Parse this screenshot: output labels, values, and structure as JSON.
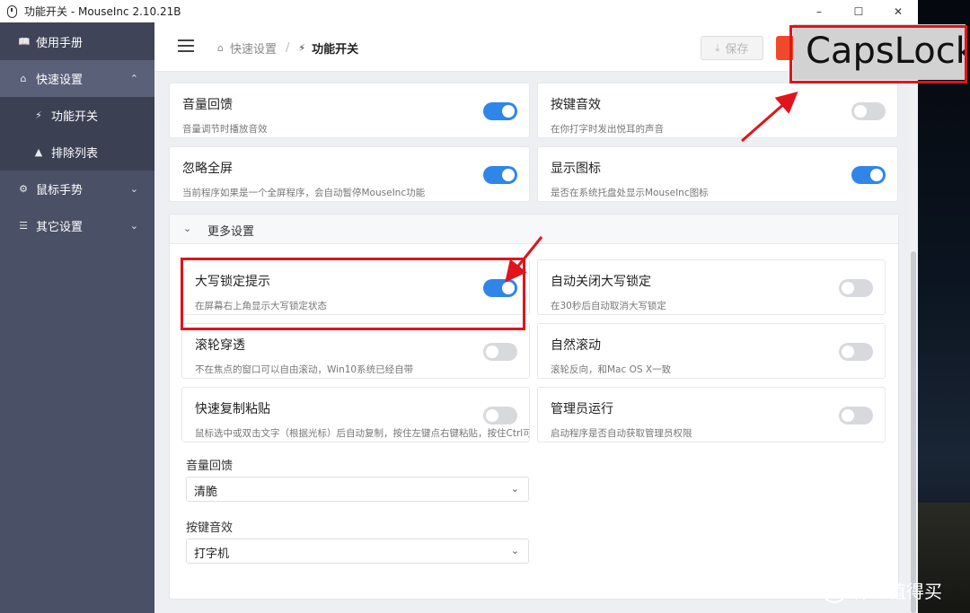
{
  "window": {
    "title": "功能开关 - MouseInc 2.10.21B",
    "controls": [
      "–",
      "☐",
      "✕"
    ]
  },
  "sidebar": {
    "manual": "使用手册",
    "items": [
      {
        "label": "快速设置",
        "icon": "home-icon",
        "expanded": true
      },
      {
        "label": "功能开关",
        "icon": "bolt-icon",
        "sub": true
      },
      {
        "label": "排除列表",
        "icon": "warning-icon",
        "sub": true
      },
      {
        "label": "鼠标手势",
        "icon": "gear-icon",
        "expanded": false
      },
      {
        "label": "其它设置",
        "icon": "sliders-icon",
        "expanded": false
      }
    ]
  },
  "header": {
    "breadcrumb": [
      "快速设置",
      "功能开关"
    ],
    "save_label": "保存"
  },
  "cards_top": [
    {
      "title": "音量回馈",
      "desc": "音量调节时播放音效",
      "on": true
    },
    {
      "title": "按键音效",
      "desc": "在你打字时发出悦耳的声音",
      "on": false
    },
    {
      "title": "忽略全屏",
      "desc": "当前程序如果是一个全屏程序，会自动暂停MouseInc功能",
      "on": true
    },
    {
      "title": "显示图标",
      "desc": "是否在系统托盘处显示MouseInc图标",
      "on": true
    }
  ],
  "more": {
    "label": "更多设置",
    "cards": [
      {
        "title": "大写锁定提示",
        "desc": "在屏幕右上角显示大写锁定状态",
        "on": true
      },
      {
        "title": "自动关闭大写锁定",
        "desc": "在30秒后自动取消大写锁定",
        "on": false
      },
      {
        "title": "滚轮穿透",
        "desc": "不在焦点的窗口可以自由滚动，Win10系统已经自带",
        "on": false
      },
      {
        "title": "自然滚动",
        "desc": "滚轮反向，和Mac OS X一致",
        "on": false
      },
      {
        "title": "快速复制粘贴",
        "desc": "鼠标选中或双击文字（根据光标）后自动复制，按住左键点右键粘贴，按住Ctrl可临时禁用",
        "on": false
      },
      {
        "title": "管理员运行",
        "desc": "启动程序是否自动获取管理员权限",
        "on": false
      }
    ],
    "volume_feedback": {
      "label": "音量回馈",
      "value": "清脆"
    },
    "key_sound": {
      "label": "按键音效",
      "value": "打字机"
    }
  },
  "overlay": {
    "caps_text": "CapsLock",
    "watermark": "什么值得买",
    "watermark_badge": "值"
  },
  "colors": {
    "toggle_on": "#2f86e8",
    "toggle_off": "#d7d9dd",
    "highlight": "#e2141b",
    "sidebar_bg": "#4a5066"
  }
}
